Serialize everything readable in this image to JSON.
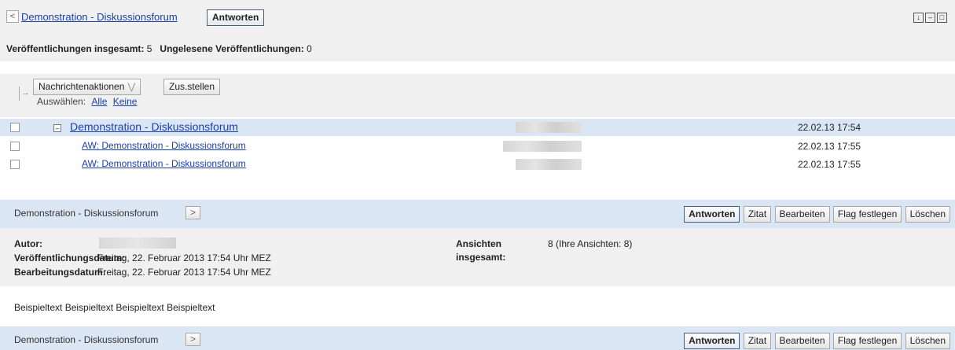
{
  "header": {
    "back_symbol": "<",
    "breadcrumb": "Demonstration - Diskussionsforum",
    "reply_label": "Antworten",
    "stats_total_label": "Veröffentlichungen insgesamt:",
    "stats_total_value": "5",
    "stats_unread_label": "Ungelesene Veröffentlichungen:",
    "stats_unread_value": "0"
  },
  "actions": {
    "message_actions_label": "Nachrichtenaktionen",
    "compose_label": "Zus.stellen",
    "select_label": "Auswählen:",
    "select_all": "Alle",
    "select_none": "Keine"
  },
  "list": {
    "rows": [
      {
        "title": "Demonstration - Diskussionsforum",
        "date": "22.02.13 17:54"
      },
      {
        "title": "AW: Demonstration - Diskussionsforum",
        "date": "22.02.13 17:55"
      },
      {
        "title": "AW: Demonstration - Diskussionsforum",
        "date": "22.02.13 17:55"
      }
    ]
  },
  "detail": {
    "title": "Demonstration - Diskussionsforum",
    "next_symbol": ">",
    "buttons": {
      "reply": "Antworten",
      "quote": "Zitat",
      "edit": "Bearbeiten",
      "flag": "Flag festlegen",
      "delete": "Löschen"
    },
    "author_label": "Autor:",
    "published_label": "Veröffentlichungsdatum:",
    "published_value": "Freitag, 22. Februar 2013 17:54 Uhr MEZ",
    "edited_label": "Bearbeitungsdatum:",
    "edited_value": "Freitag, 22. Februar 2013 17:54 Uhr MEZ",
    "views_label_1": "Ansichten",
    "views_label_2": "insgesamt:",
    "views_value": "8 (Ihre Ansichten: 8)",
    "body": "Beispieltext Beispieltext Beispieltext Beispieltext"
  },
  "icons": {
    "back": "chevron-left-icon",
    "next": "chevron-right-icon",
    "window_controls": [
      "download-icon",
      "minimize-icon",
      "restore-icon"
    ]
  }
}
